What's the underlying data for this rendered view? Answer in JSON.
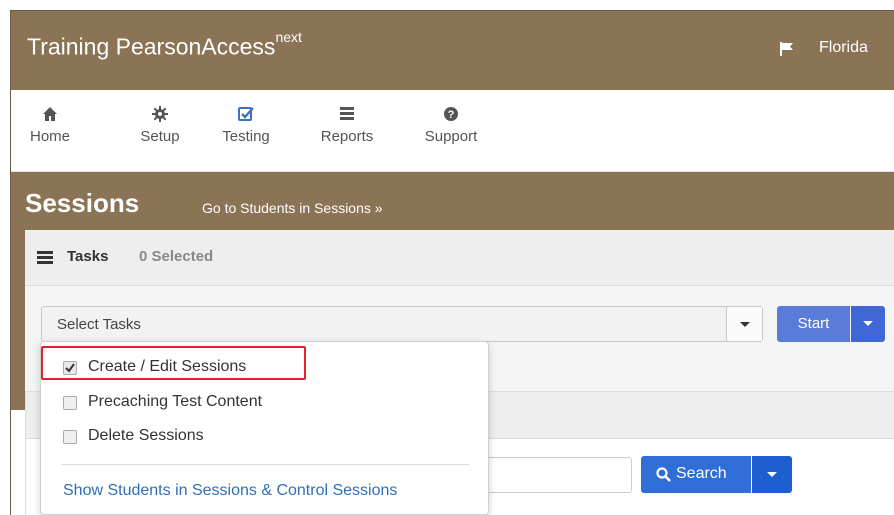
{
  "header": {
    "brand": "Training PearsonAccess",
    "brand_sup": "next",
    "org": "Florida",
    "flag_icon": "flag-icon"
  },
  "nav": {
    "items": [
      {
        "label": "Home",
        "icon": "home-icon"
      },
      {
        "label": "Setup",
        "icon": "gear-icon"
      },
      {
        "label": "Testing",
        "icon": "check-square-icon"
      },
      {
        "label": "Reports",
        "icon": "list-icon"
      },
      {
        "label": "Support",
        "icon": "question-circle-icon"
      }
    ]
  },
  "page": {
    "title": "Sessions",
    "goto_link": "Go to Students in Sessions »"
  },
  "tasks": {
    "label": "Tasks",
    "selected_count": "0 Selected",
    "select_value": "Select Tasks",
    "start_label": "Start"
  },
  "menu": {
    "items": [
      {
        "label": "Create / Edit Sessions",
        "checked": true
      },
      {
        "label": "Precaching Test Content",
        "checked": false
      },
      {
        "label": "Delete Sessions",
        "checked": false
      }
    ],
    "link": "Show Students in Sessions & Control Sessions"
  },
  "search": {
    "button_label": "Search",
    "value": ""
  },
  "colors": {
    "brand_brown": "#8b7355",
    "primary_blue": "#2f6ed6",
    "highlight_red": "#e0232f"
  }
}
